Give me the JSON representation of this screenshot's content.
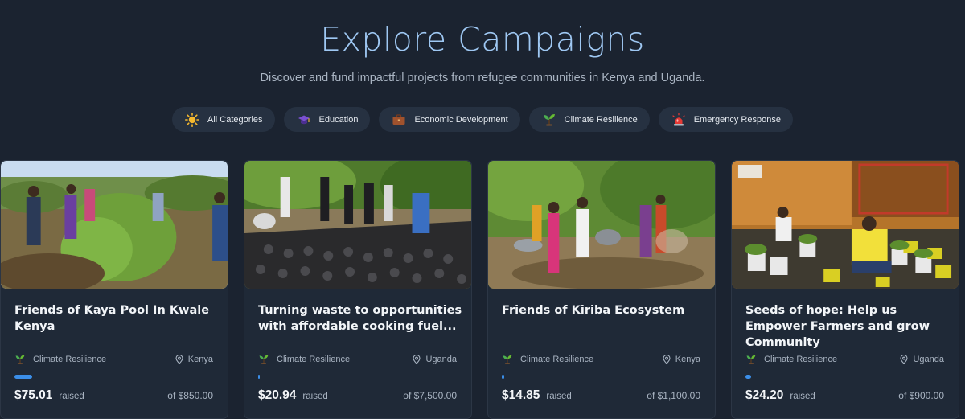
{
  "header": {
    "title": "Explore Campaigns",
    "subtitle": "Discover and fund impactful projects from refugee communities in Kenya and Uganda."
  },
  "filters": [
    {
      "label": "All Categories",
      "icon": "sun-icon"
    },
    {
      "label": "Education",
      "icon": "graduation-cap-icon"
    },
    {
      "label": "Economic Development",
      "icon": "briefcase-icon"
    },
    {
      "label": "Climate Resilience",
      "icon": "seedling-icon"
    },
    {
      "label": "Emergency Response",
      "icon": "siren-icon"
    }
  ],
  "campaigns": [
    {
      "title": "Friends of Kaya Pool In Kwale Kenya",
      "category": "Climate Resilience",
      "location": "Kenya",
      "amount": "$75.01",
      "raised_label": "raised",
      "goal": "of $850.00",
      "progress": 0.088
    },
    {
      "title": "Turning waste to opportunities with affordable cooking fuel...",
      "category": "Climate Resilience",
      "location": "Uganda",
      "amount": "$20.94",
      "raised_label": "raised",
      "goal": "of $7,500.00",
      "progress": 0.003
    },
    {
      "title": "Friends of Kiriba Ecosystem",
      "category": "Climate Resilience",
      "location": "Kenya",
      "amount": "$14.85",
      "raised_label": "raised",
      "goal": "of $1,100.00",
      "progress": 0.0135
    },
    {
      "title": "Seeds of hope: Help us Empower Farmers and grow Community",
      "category": "Climate Resilience",
      "location": "Uganda",
      "amount": "$24.20",
      "raised_label": "raised",
      "goal": "of $900.00",
      "progress": 0.027
    }
  ],
  "colors": {
    "background": "#1b2330",
    "card": "#1f2937",
    "accent": "#3b8ee8",
    "title": "#9fc8f3"
  }
}
